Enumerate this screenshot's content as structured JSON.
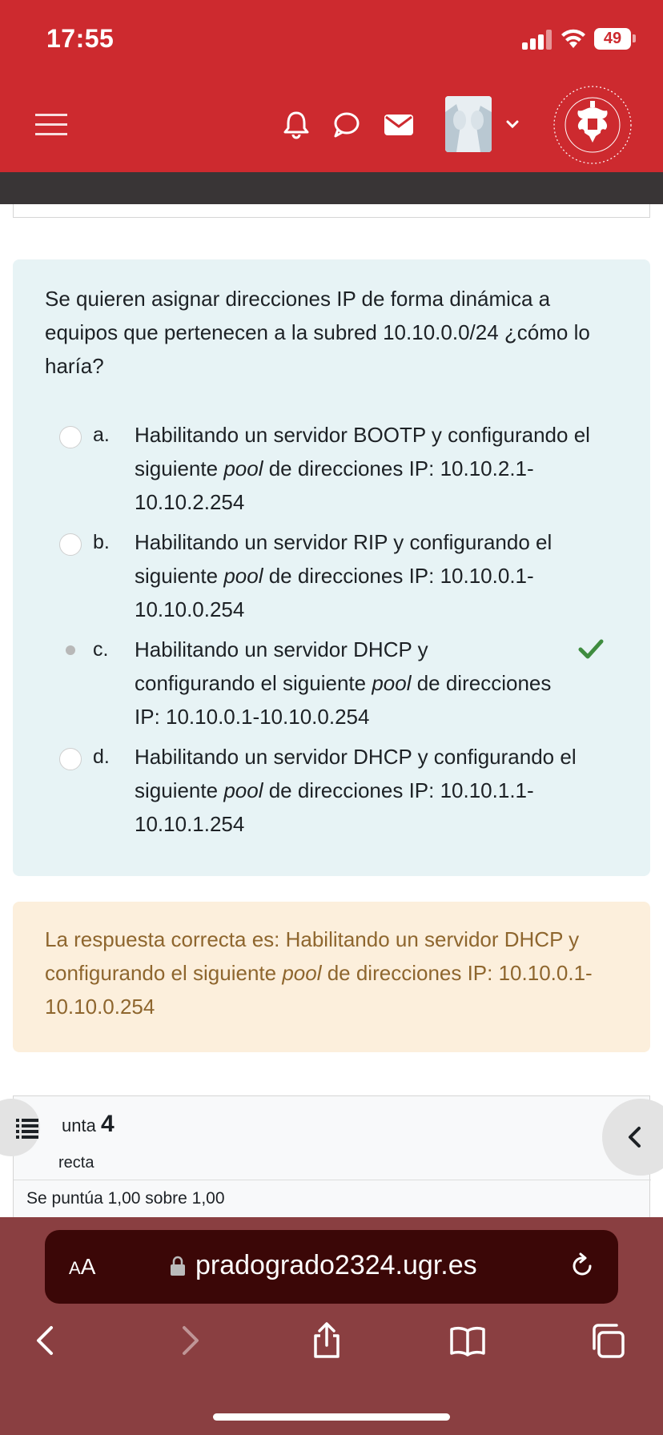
{
  "status_bar": {
    "time": "17:55",
    "battery": "49"
  },
  "header": {
    "icons": [
      "menu-icon",
      "bell-icon",
      "chat-icon",
      "mail-icon",
      "avatar",
      "chevron-down-icon",
      "university-logo"
    ]
  },
  "question": {
    "text": "Se quieren asignar direcciones IP de forma dinámica a equipos que pertenecen a la subred 10.10.0.0/24 ¿cómo lo haría?",
    "options": [
      {
        "letter": "a.",
        "line1_pre": "Habilitando un servidor BOOTP y configurando el",
        "line2_pre": "siguiente ",
        "italic": "pool",
        "line2_post": " de direcciones IP: 10.10.2.1-",
        "line3": "10.10.2.254",
        "selected": false
      },
      {
        "letter": "b.",
        "line1_pre": "Habilitando un servidor RIP y configurando el",
        "line2_pre": "siguiente ",
        "italic": "pool",
        "line2_post": " de direcciones IP: 10.10.0.1-",
        "line3": "10.10.0.254",
        "selected": false
      },
      {
        "letter": "c.",
        "line1_pre": "Habilitando un servidor DHCP y",
        "line2_pre": "configurando el siguiente ",
        "italic": "pool",
        "line2_post": " de direcciones",
        "line3": "IP: 10.10.0.1-10.10.0.254",
        "selected": true,
        "correct": true
      },
      {
        "letter": "d.",
        "line1_pre": "Habilitando un servidor DHCP y configurando el",
        "line2_pre": "siguiente ",
        "italic": "pool",
        "line2_post": " de direcciones IP: 10.10.1.1-",
        "line3": "10.10.1.254",
        "selected": false
      }
    ]
  },
  "feedback": {
    "line1": "La respuesta correcta es: Habilitando un servidor DHCP y",
    "line2_pre": "configurando el siguiente ",
    "italic": "pool",
    "line2_post": " de direcciones IP: 10.10.0.1-",
    "line3": "10.10.0.254"
  },
  "next_question": {
    "title_prefix": "unta",
    "number": "4",
    "status": "recta",
    "grade": "Se puntúa 1,00 sobre 1,00"
  },
  "browser": {
    "aa_label_big": "A",
    "aa_label_small": "A",
    "url": "pradogrado2324.ugr.es"
  },
  "colors": {
    "header_red": "#cd2a2f",
    "question_bg": "#e7f3f5",
    "feedback_bg": "#fcefdc",
    "feedback_text": "#8e662e",
    "correct_green": "#3f8c3f",
    "safari_bar": "#8a3f41"
  }
}
